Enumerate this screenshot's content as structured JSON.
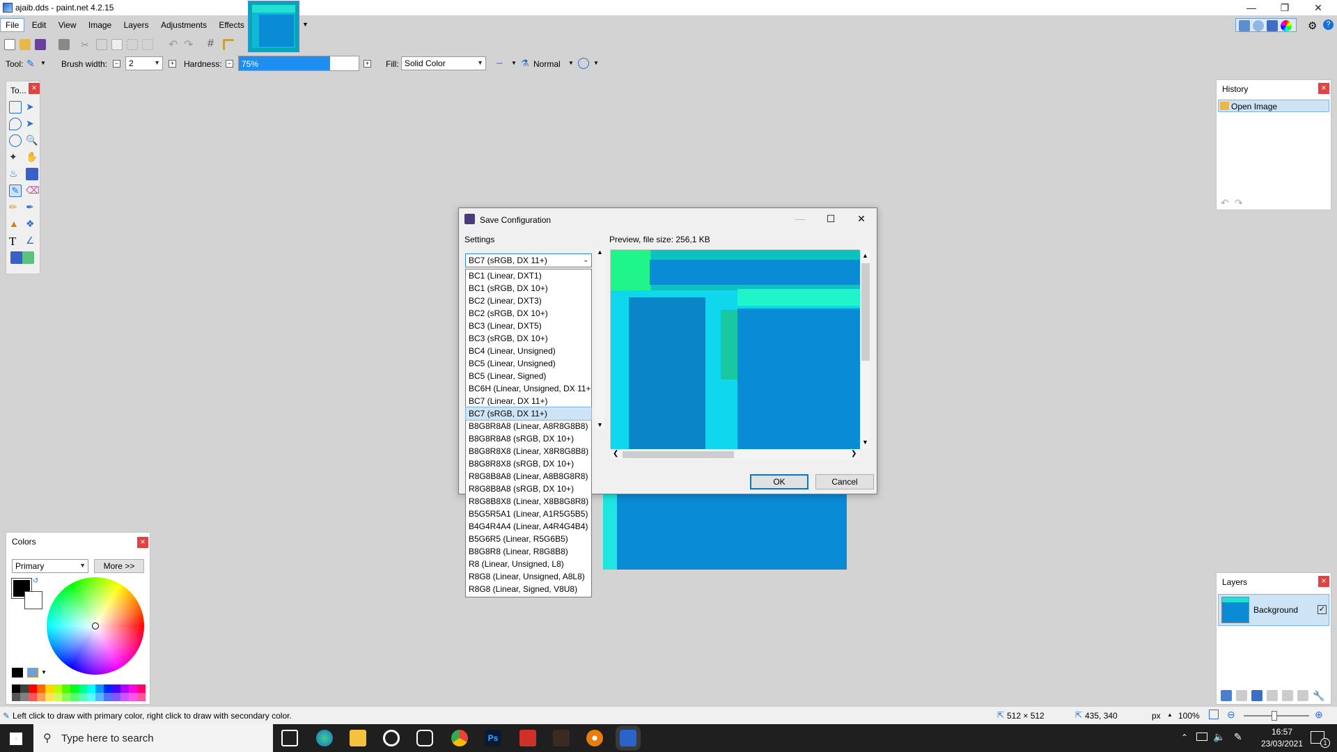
{
  "window": {
    "title": "ajaib.dds - paint.net 4.2.15"
  },
  "menu": [
    "File",
    "Edit",
    "View",
    "Image",
    "Layers",
    "Adjustments",
    "Effects"
  ],
  "toolbar": {
    "tool_label": "Tool:",
    "brush_width_label": "Brush width:",
    "brush_width_value": "2",
    "hardness_label": "Hardness:",
    "hardness_value": "75%",
    "hardness_level": 0.75,
    "fill_label": "Fill:",
    "fill_value": "Solid Color",
    "blend_mode": "Normal"
  },
  "tools_panel": {
    "title": "To..."
  },
  "history_panel": {
    "title": "History",
    "items": [
      "Open Image"
    ]
  },
  "layers_panel": {
    "title": "Layers",
    "layers": [
      {
        "name": "Background",
        "visible": true
      }
    ]
  },
  "colors_panel": {
    "title": "Colors",
    "mode": "Primary",
    "more_button": "More >>"
  },
  "palette": [
    "#000000",
    "#404040",
    "#ff0000",
    "#ff6a00",
    "#ffd800",
    "#b6ff00",
    "#4cff00",
    "#00ff21",
    "#00ff90",
    "#00ffff",
    "#0094ff",
    "#0026ff",
    "#4800ff",
    "#b200ff",
    "#ff00dc",
    "#ff006e"
  ],
  "status": {
    "hint": "Left click to draw with primary color, right click to draw with secondary color.",
    "image_size": "512 × 512",
    "cursor": "435, 340",
    "unit": "px",
    "zoom": "100%"
  },
  "taskbar": {
    "search_placeholder": "Type here to search",
    "time": "16:57",
    "date": "23/03/2021",
    "notification_count": "1"
  },
  "dialog": {
    "title": "Save Configuration",
    "settings_label": "Settings",
    "preview_label": "Preview, file size: 256,1 KB",
    "selected_format": "BC7 (sRGB, DX 11+)",
    "formats": [
      "BC1 (Linear, DXT1)",
      "BC1 (sRGB, DX 10+)",
      "BC2 (Linear, DXT3)",
      "BC2 (sRGB, DX 10+)",
      "BC3 (Linear, DXT5)",
      "BC3 (sRGB, DX 10+)",
      "BC4 (Linear, Unsigned)",
      "BC5 (Linear, Unsigned)",
      "BC5 (Linear, Signed)",
      "BC6H (Linear, Unsigned, DX 11+)",
      "BC7 (Linear, DX 11+)",
      "BC7 (sRGB, DX 11+)",
      "B8G8R8A8 (Linear, A8R8G8B8)",
      "B8G8R8A8 (sRGB, DX 10+)",
      "B8G8R8X8 (Linear, X8R8G8B8)",
      "B8G8R8X8 (sRGB, DX 10+)",
      "R8G8B8A8 (Linear, A8B8G8R8)",
      "R8G8B8A8 (sRGB, DX 10+)",
      "R8G8B8X8 (Linear, X8B8G8R8)",
      "B5G5R5A1 (Linear, A1R5G5B5)",
      "B4G4R4A4 (Linear, A4R4G4B4)",
      "B5G6R5 (Linear, R5G6B5)",
      "B8G8R8 (Linear, R8G8B8)",
      "R8 (Linear, Unsigned, L8)",
      "R8G8 (Linear, Unsigned, A8L8)",
      "R8G8 (Linear, Signed, V8U8)"
    ],
    "ok_label": "OK",
    "cancel_label": "Cancel"
  }
}
